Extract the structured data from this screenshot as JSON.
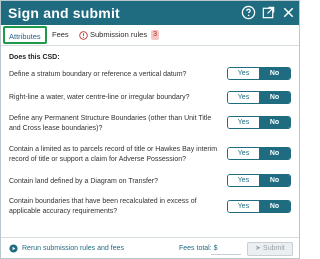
{
  "dialog": {
    "title": "Sign and submit",
    "header_icons": [
      "help-circle-icon",
      "external-link-icon",
      "close-icon"
    ]
  },
  "tabs": [
    {
      "label": "Attributes",
      "selected": true
    },
    {
      "label": "Fees"
    },
    {
      "label": "Submission rules",
      "badge": "3",
      "icon": "warning-circle-icon"
    }
  ],
  "form": {
    "prompt": "Does this CSD:",
    "questions": [
      {
        "text": "Define a stratum boundary or reference a vertical datum?",
        "yes": "Yes",
        "no": "No",
        "selected": "No"
      },
      {
        "text": "Right-line a water, water centre-line or irregular boundary?",
        "yes": "Yes",
        "no": "No",
        "selected": "No"
      },
      {
        "text": "Define any Permanent Structure Boundaries (other than Unit Title and Cross lease boundaries)?",
        "yes": "Yes",
        "no": "No",
        "selected": "No"
      },
      {
        "text": "Contain a limited as to parcels record of title or Hawkes Bay interim record of title or support a claim for Adverse Possession?",
        "yes": "Yes",
        "no": "No",
        "selected": "No"
      },
      {
        "text": "Contain land defined by a Diagram on Transfer?",
        "yes": "Yes",
        "no": "No",
        "selected": "No"
      },
      {
        "text": "Contain boundaries that have been recalculated in excess of applicable accuracy requirements?",
        "yes": "Yes",
        "no": "No",
        "selected": "No"
      }
    ]
  },
  "footer": {
    "rerun_label": "Rerun submission rules and fees",
    "fees_label": "Fees total: $",
    "fees_value": "",
    "submit_label": "Submit"
  },
  "colors": {
    "header": "#1f6b80",
    "tab_highlight": "#1f9a4a",
    "badge_bg": "#f6c7c7",
    "badge_text": "#b3261e"
  }
}
